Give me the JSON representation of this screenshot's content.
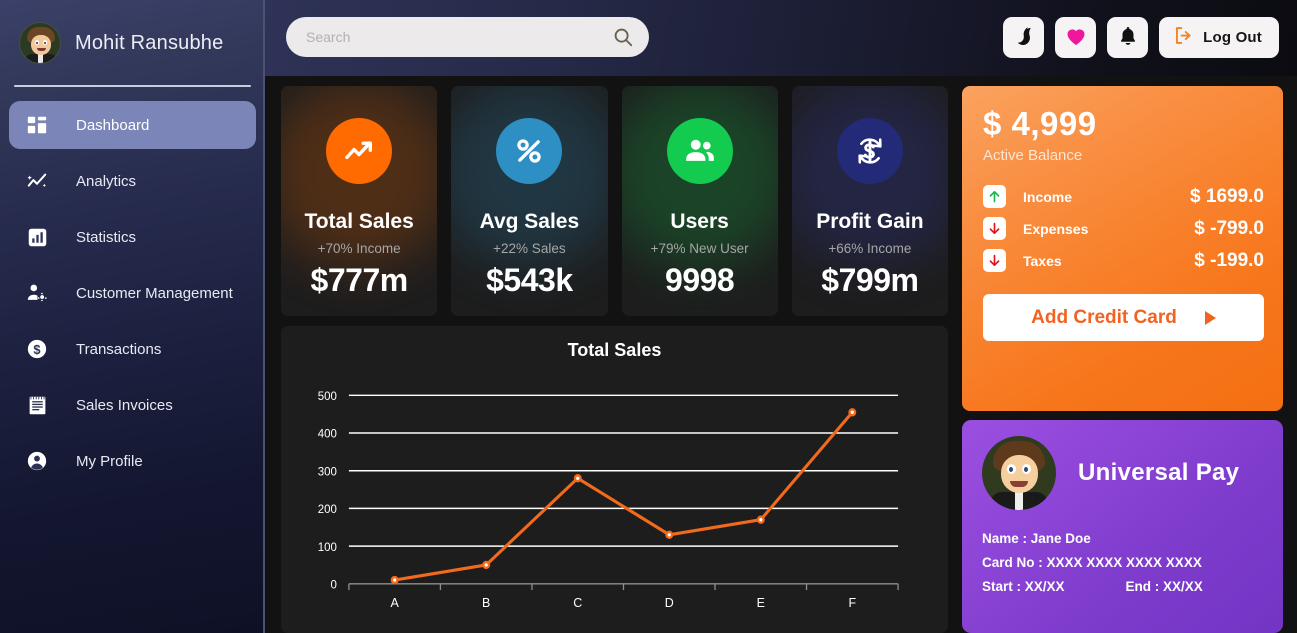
{
  "sidebar": {
    "profile_name": "Mohit Ransubhe",
    "avatar_icon": "user-avatar",
    "items": [
      {
        "label": "Dashboard",
        "icon": "dashboard-grid-icon",
        "active": true
      },
      {
        "label": "Analytics",
        "icon": "analytics-trend-icon",
        "active": false
      },
      {
        "label": "Statistics",
        "icon": "bar-chart-icon",
        "active": false
      },
      {
        "label": "Customer Management",
        "icon": "user-settings-icon",
        "active": false
      },
      {
        "label": "Transactions",
        "icon": "dollar-circle-icon",
        "active": false
      },
      {
        "label": "Sales Invoices",
        "icon": "receipt-icon",
        "active": false
      },
      {
        "label": "My Profile",
        "icon": "account-circle-icon",
        "active": false
      }
    ]
  },
  "topbar": {
    "search": {
      "placeholder": "Search",
      "value": "",
      "icon": "search-icon"
    },
    "actions": [
      {
        "icon": "dark-mode-moon-icon",
        "name": "dark-mode-toggle",
        "color": "#111111"
      },
      {
        "icon": "heart-icon",
        "name": "favorites-button",
        "color": "#f0179c"
      },
      {
        "icon": "bell-icon",
        "name": "notifications-button",
        "color": "#111111"
      }
    ],
    "logout": {
      "label": "Log Out",
      "icon": "logout-icon",
      "icon_color": "#f58220"
    }
  },
  "stats": [
    {
      "title": "Total Sales",
      "sub": "+70% Income",
      "value": "$777m",
      "icon": "trending-up-icon",
      "color": "#ff6b00"
    },
    {
      "title": "Avg Sales",
      "sub": "+22% Sales",
      "value": "$543k",
      "icon": "percent-icon",
      "color": "#2d8fc4"
    },
    {
      "title": "Users",
      "sub": "+79% New User",
      "value": "9998",
      "icon": "people-icon",
      "color": "#13cc4f"
    },
    {
      "title": "Profit Gain",
      "sub": "+66% Income",
      "value": "$799m",
      "icon": "currency-swap-icon",
      "color": "#232a78"
    }
  ],
  "chart_data": {
    "type": "line",
    "title": "Total Sales",
    "categories": [
      "A",
      "B",
      "C",
      "D",
      "E",
      "F"
    ],
    "values": [
      10,
      50,
      280,
      130,
      170,
      455
    ],
    "series": [
      {
        "name": "Total Sales",
        "values": [
          10,
          50,
          280,
          130,
          170,
          455
        ]
      }
    ],
    "xlabel": "",
    "ylabel": "",
    "ylim": [
      0,
      500
    ],
    "yticks": [
      0,
      100,
      200,
      300,
      400,
      500
    ],
    "grid": true,
    "legend": "none",
    "line_color": "#f26a1b",
    "marker_color": "#f26a1b",
    "marker_fill": "#ffffff"
  },
  "balance": {
    "amount": "$ 4,999",
    "label": "Active Balance",
    "rows": [
      {
        "name": "Income",
        "value": "$ 1699.0",
        "icon": "arrow-up-icon",
        "icon_color": "#17b84a"
      },
      {
        "name": "Expenses",
        "value": "$ -799.0",
        "icon": "arrow-down-icon",
        "icon_color": "#e01414"
      },
      {
        "name": "Taxes",
        "value": "$ -199.0",
        "icon": "arrow-down-icon",
        "icon_color": "#e01414"
      }
    ],
    "button": {
      "label": "Add Credit Card",
      "icon": "play-arrow-icon"
    }
  },
  "pay_card": {
    "brand": "Universal Pay",
    "avatar_icon": "user-avatar",
    "name_line": "Name : Jane Doe",
    "card_no_line": "Card No : XXXX XXXX XXXX XXXX",
    "start_line": "Start : XX/XX",
    "end_line": "End : XX/XX"
  }
}
